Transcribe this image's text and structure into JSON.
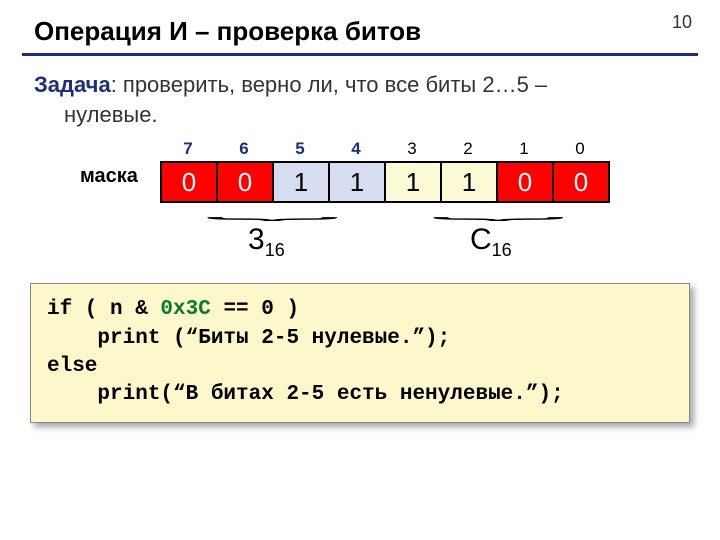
{
  "page_number": "10",
  "title": "Операция И – проверка битов",
  "task_lead": "Задача",
  "task_text_1": ": проверить, верно ли, что все биты 2…5 –",
  "task_text_2": "нулевые.",
  "mask_label": "маска",
  "bit_indices": [
    "7",
    "6",
    "5",
    "4",
    "3",
    "2",
    "1",
    "0"
  ],
  "mask_bits": [
    "0",
    "0",
    "1",
    "1",
    "1",
    "1",
    "0",
    "0"
  ],
  "hex_left_base": "3",
  "hex_left_sub": "16",
  "hex_right_base": "C",
  "hex_right_sub": "16",
  "code": {
    "l1a": "if ( n & ",
    "l1b": "0x3C",
    "l1c": " == 0 )",
    "l2": "    print (“Биты 2-5 нулевые.”);",
    "l3": "else",
    "l4": "    print(“В битах 2-5 есть ненулевые.”);"
  }
}
